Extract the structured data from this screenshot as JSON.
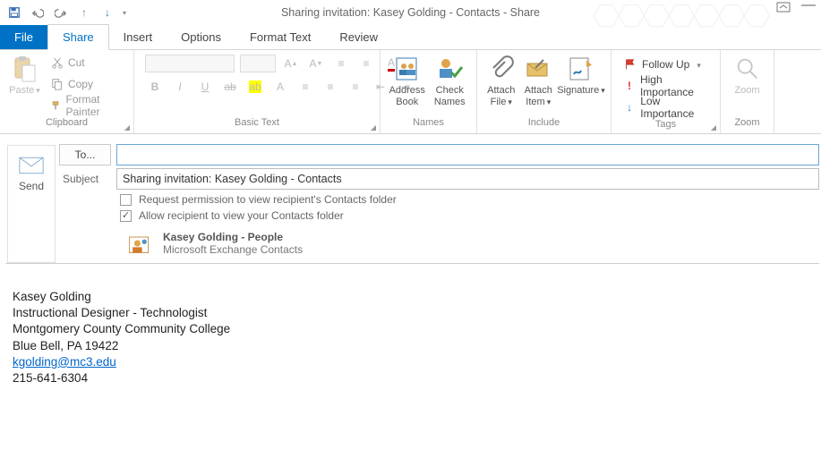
{
  "window": {
    "title": "Sharing invitation: Kasey Golding - Contacts - Share"
  },
  "qat": {
    "save": "save-icon",
    "undo": "undo-icon",
    "redo": "redo-icon",
    "prev": "up-icon",
    "next": "down-icon"
  },
  "tabs": {
    "file": "File",
    "items": [
      {
        "id": "share",
        "label": "Share",
        "active": true
      },
      {
        "id": "insert",
        "label": "Insert"
      },
      {
        "id": "options",
        "label": "Options"
      },
      {
        "id": "formattext",
        "label": "Format Text"
      },
      {
        "id": "review",
        "label": "Review"
      }
    ]
  },
  "ribbon": {
    "clipboard": {
      "label": "Clipboard",
      "paste": "Paste",
      "cut": "Cut",
      "copy": "Copy",
      "format_painter": "Format Painter"
    },
    "basic_text": {
      "label": "Basic Text"
    },
    "names": {
      "label": "Names",
      "address_book": "Address Book",
      "check_names": "Check Names"
    },
    "include": {
      "label": "Include",
      "attach_file": "Attach File",
      "attach_item": "Attach Item",
      "signature": "Signature"
    },
    "tags": {
      "label": "Tags",
      "follow_up": "Follow Up",
      "high": "High Importance",
      "low": "Low Importance"
    },
    "zoom": {
      "label": "Zoom",
      "zoom": "Zoom"
    }
  },
  "compose": {
    "send": "Send",
    "to_label": "To...",
    "to_value": "",
    "subject_label": "Subject",
    "subject_value": "Sharing invitation: Kasey Golding - Contacts",
    "chk_request": "Request permission to view recipient's Contacts folder",
    "chk_allow": "Allow recipient to view your Contacts folder",
    "share_title": "Kasey Golding - People",
    "share_sub": "Microsoft Exchange Contacts"
  },
  "signature": {
    "name": "Kasey Golding",
    "title": "Instructional Designer - Technologist",
    "org": "Montgomery County Community College",
    "addr": "Blue Bell, PA 19422",
    "email": "kgolding@mc3.edu",
    "phone": "215-641-6304"
  }
}
